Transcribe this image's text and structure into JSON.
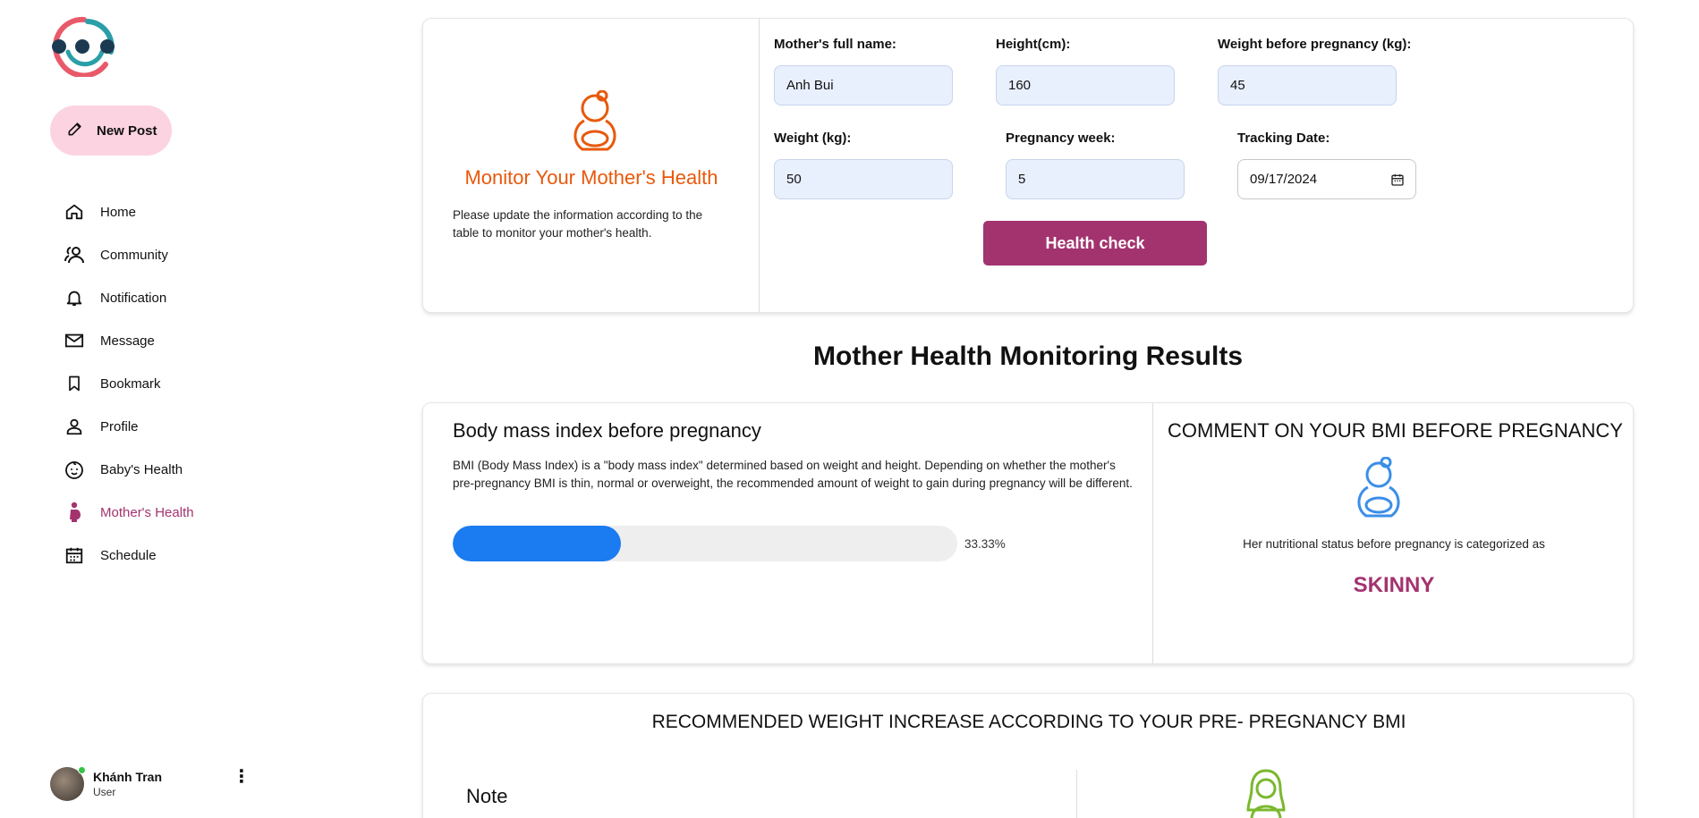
{
  "sidebar": {
    "new_post_label": "New Post",
    "items": [
      {
        "label": "Home",
        "icon": "home-icon"
      },
      {
        "label": "Community",
        "icon": "community-icon"
      },
      {
        "label": "Notification",
        "icon": "bell-icon"
      },
      {
        "label": "Message",
        "icon": "envelope-icon"
      },
      {
        "label": "Bookmark",
        "icon": "bookmark-icon"
      },
      {
        "label": "Profile",
        "icon": "person-icon"
      },
      {
        "label": "Baby's Health",
        "icon": "baby-icon"
      },
      {
        "label": "Mother's Health",
        "icon": "pregnant-icon",
        "active": true
      },
      {
        "label": "Schedule",
        "icon": "calendar-icon"
      }
    ],
    "user": {
      "name": "Khánh Tran",
      "role": "User"
    }
  },
  "form": {
    "title": "Monitor Your Mother's Health",
    "description": "Please update the information according to the table to monitor your mother's health.",
    "fields": {
      "name": {
        "label": "Mother's full name:",
        "value": "Anh Bui"
      },
      "height": {
        "label": "Height(cm):",
        "value": "160"
      },
      "weight_before": {
        "label": "Weight before pregnancy (kg):",
        "value": "45"
      },
      "weight": {
        "label": "Weight (kg):",
        "value": "50"
      },
      "pregnancy_week": {
        "label": "Pregnancy week:",
        "value": "5"
      },
      "tracking_date": {
        "label": "Tracking Date:",
        "value": "09/17/2024"
      }
    },
    "submit_label": "Health check"
  },
  "results": {
    "title": "Mother Health Monitoring Results",
    "bmi": {
      "title": "Body mass index before pregnancy",
      "description": "BMI (Body Mass Index) is a \"body mass index\" determined based on weight and height. Depending on whether the mother's pre-pregnancy BMI is thin, normal or overweight, the recommended amount of weight to gain during pregnancy will be different.",
      "progress_percent": 33.33,
      "progress_label": "33.33%",
      "comment_title": "COMMENT ON YOUR BMI BEFORE PREGNANCY",
      "status_text": "Her nutritional status before pregnancy is categorized as",
      "category": "SKINNY"
    },
    "recommendation": {
      "title": "RECOMMENDED WEIGHT INCREASE ACCORDING TO YOUR PRE- PREGNANCY BMI",
      "note_title": "Note"
    }
  },
  "colors": {
    "accent": "#a3336f",
    "new_post_bg": "#fcd3e0",
    "orange": "#e8590c",
    "progress": "#1b7bf0",
    "blue_icon": "#3b8ee8",
    "green_icon": "#7ab82e"
  }
}
